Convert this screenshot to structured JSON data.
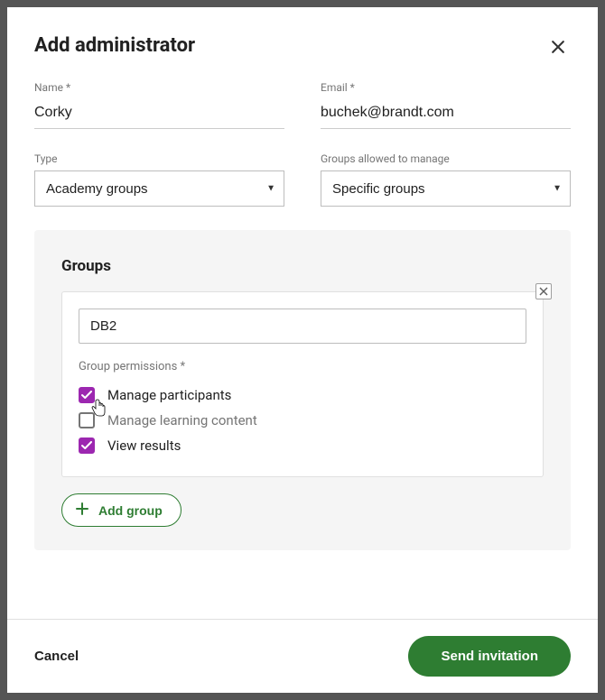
{
  "modal": {
    "title": "Add administrator"
  },
  "fields": {
    "name_label": "Name *",
    "name_value": "Corky",
    "email_label": "Email *",
    "email_value": "buchek@brandt.com",
    "type_label": "Type",
    "type_value": "Academy groups",
    "groups_allowed_label": "Groups allowed to manage",
    "groups_allowed_value": "Specific groups"
  },
  "groups_panel": {
    "title": "Groups",
    "group_name_value": "DB2",
    "permissions_label": "Group permissions *",
    "permissions": [
      {
        "label": "Manage participants",
        "checked": true
      },
      {
        "label": "Manage learning content",
        "checked": false
      },
      {
        "label": "View results",
        "checked": true
      }
    ],
    "add_group_label": "Add group"
  },
  "footer": {
    "cancel": "Cancel",
    "submit": "Send invitation"
  }
}
